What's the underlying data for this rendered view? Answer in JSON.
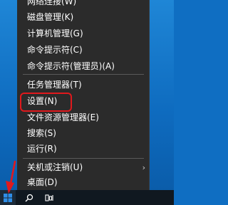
{
  "menu": {
    "items": [
      {
        "label": "网络连接(W)"
      },
      {
        "label": "磁盘管理(K)"
      },
      {
        "label": "计算机管理(G)"
      },
      {
        "label": "命令提示符(C)"
      },
      {
        "label": "命令提示符(管理员)(A)"
      },
      {
        "label": "任务管理器(T)"
      },
      {
        "label": "设置(N)"
      },
      {
        "label": "文件资源管理器(E)"
      },
      {
        "label": "搜索(S)"
      },
      {
        "label": "运行(R)"
      },
      {
        "label": "关机或注销(U)"
      },
      {
        "label": "桌面(D)"
      }
    ],
    "submenu_arrow": "›"
  },
  "taskbar": {
    "start_icon": "windows-logo-icon",
    "search_icon": "search-icon",
    "taskview_icon": "task-view-icon"
  },
  "annotation": {
    "highlight_color": "#e0191d",
    "arrow_color": "#e0191d"
  }
}
